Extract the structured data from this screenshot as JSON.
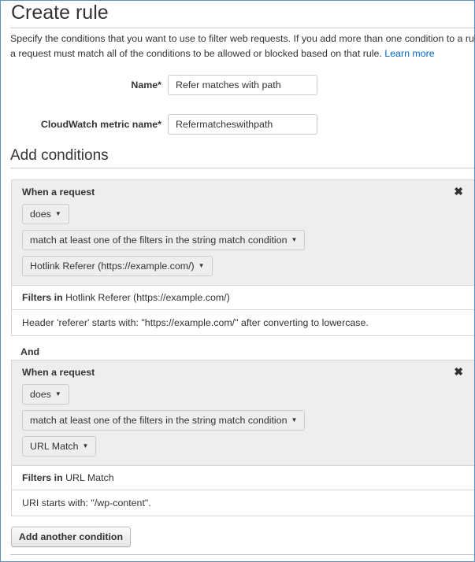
{
  "header": {
    "title": "Create rule",
    "description": "Specify the conditions that you want to use to filter web requests. If you add more than one condition to a rule, a request must match all of the conditions to be allowed or blocked based on that rule.",
    "description_line1": "Specify the conditions that you want to use to filter web requests. If you add more than one condition to a rule,",
    "description_line2": "a request must match all of the conditions to be allowed or blocked based on that rule.",
    "learn_more": "Learn more"
  },
  "form": {
    "name_label": "Name*",
    "name_value": "Refer matches with path",
    "metric_label": "CloudWatch metric name*",
    "metric_value": "Refermatcheswithpath"
  },
  "conditions_section": {
    "title": "Add conditions",
    "and_label": "And",
    "conditions": [
      {
        "title": "When a request",
        "close_icon": "×",
        "does_select": "does",
        "match_select": "match at least one of the filters in the string match condition",
        "condition_select": "Hotlink Referer (https://example.com/)",
        "filters_label": "Filters in",
        "filters_name": "Hotlink Referer (https://example.com/)",
        "filter_detail": "Header 'referer' starts with: \"https://example.com/\" after converting to lowercase."
      },
      {
        "title": "When a request",
        "close_icon": "×",
        "does_select": "does",
        "match_select": "match at least one of the filters in the string match condition",
        "condition_select": "URL Match",
        "filters_label": "Filters in",
        "filters_name": "URL Match",
        "filter_detail": "URI starts with: \"/wp-content\"."
      }
    ],
    "add_button": "Add another condition"
  },
  "icons": {
    "caret": "▼",
    "close": "✖"
  },
  "colors": {
    "link": "#0066cc",
    "panel_bg": "#eeeeee",
    "border": "#d5d5d5"
  }
}
